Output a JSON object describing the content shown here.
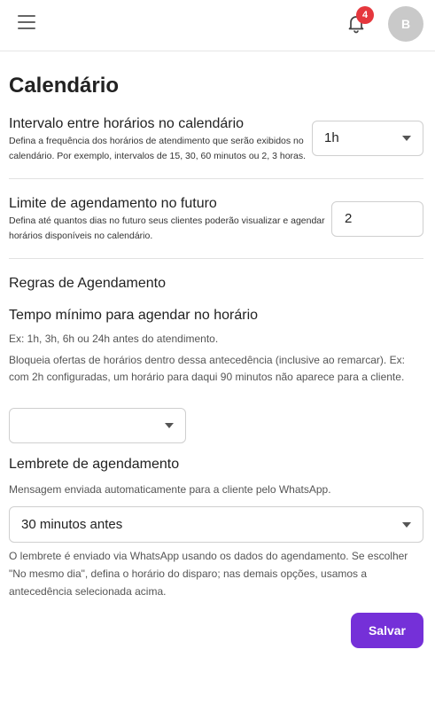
{
  "header": {
    "notification_count": "4",
    "avatar_initial": "B",
    "badge_color": "#e5373d"
  },
  "page": {
    "title": "Calendário"
  },
  "interval": {
    "title": "Intervalo entre horários no calendário",
    "description": "Defina a frequência dos horários de atendimento que serão exibidos no calendário. Por exemplo, intervalos de 15, 30, 60 minutos ou 2, 3 horas.",
    "value": "1h"
  },
  "limit": {
    "title": "Limite de agendamento no futuro",
    "description": "Defina até quantos dias no futuro seus clientes poderão visualizar e agendar horários disponíveis no calendário.",
    "value": "2"
  },
  "rules": {
    "section_title": "Regras de Agendamento",
    "min_time": {
      "title": "Tempo mínimo para agendar no horário",
      "example": "Ex: 1h, 3h, 6h ou 24h antes do atendimento.",
      "description": "Bloqueia ofertas de horários dentro dessa antecedência (inclusive ao remarcar). Ex: com 2h configuradas, um horário para daqui 90 minutos não aparece para a cliente.",
      "value": ""
    },
    "reminder": {
      "title": "Lembrete de agendamento",
      "description": "Mensagem enviada automaticamente para a cliente pelo WhatsApp.",
      "value": "30 minutos antes",
      "note": "O lembrete é enviado via WhatsApp usando os dados do agendamento. Se escolher \"No mesmo dia\", defina o horário do disparo; nas demais opções, usamos a antecedência selecionada acima."
    }
  },
  "actions": {
    "save_label": "Salvar",
    "accent_color": "#7530d8"
  }
}
